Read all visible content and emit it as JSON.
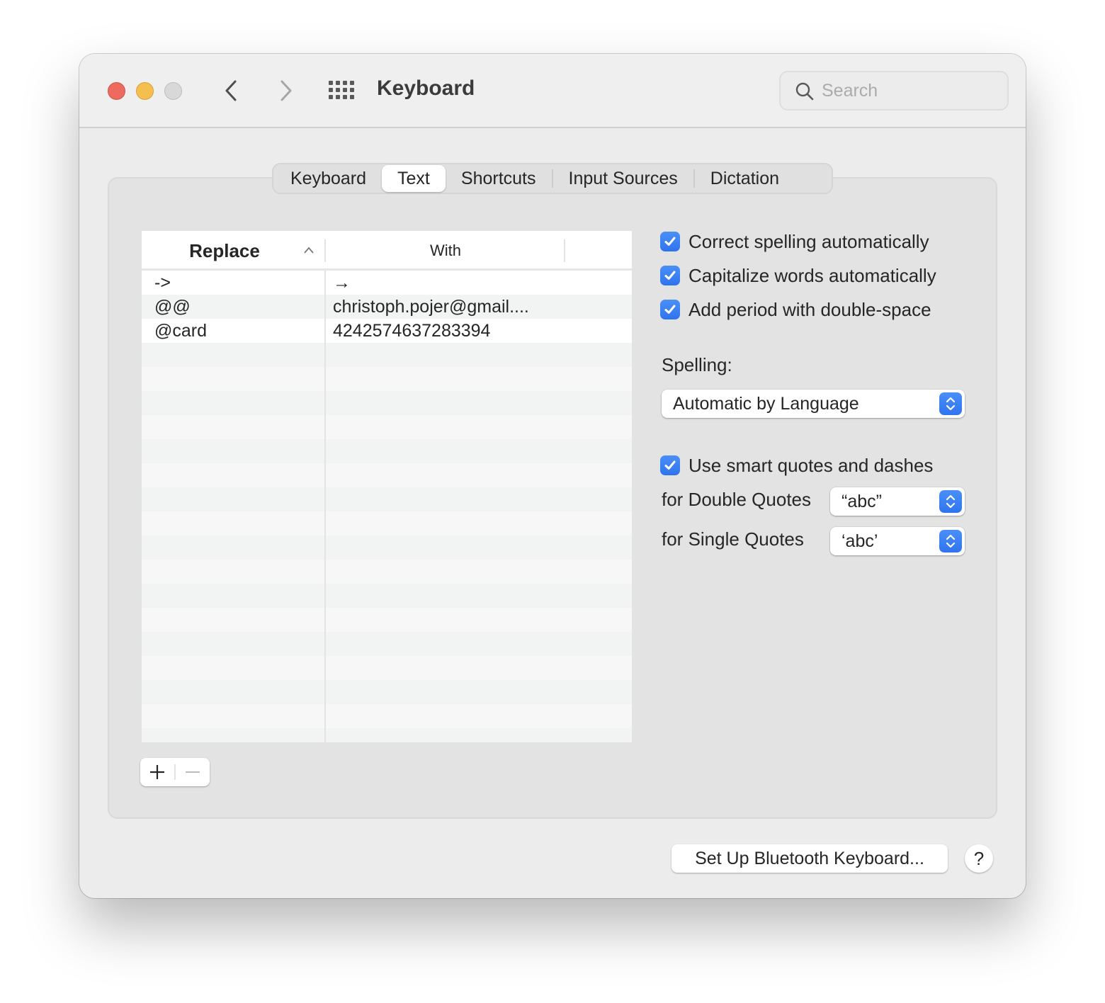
{
  "window": {
    "title": "Keyboard",
    "traffic_lights": [
      "close",
      "minimize",
      "zoom"
    ]
  },
  "toolbar": {
    "back_icon": "chevron-left-icon",
    "forward_icon": "chevron-right-icon",
    "grid_icon": "show-all-grid-icon",
    "search": {
      "placeholder": "Search",
      "value": ""
    }
  },
  "tabs": [
    {
      "label": "Keyboard",
      "active": false
    },
    {
      "label": "Text",
      "active": true
    },
    {
      "label": "Shortcuts",
      "active": false
    },
    {
      "label": "Input Sources",
      "active": false
    },
    {
      "label": "Dictation",
      "active": false
    }
  ],
  "replacements_table": {
    "columns": {
      "replace": "Replace",
      "with": "With"
    },
    "sort": {
      "column": "Replace",
      "direction": "ascending"
    },
    "rows": [
      {
        "replace": "->",
        "with": "→"
      },
      {
        "replace": "@@",
        "with": "christoph.pojer@gmail...."
      },
      {
        "replace": "@card",
        "with": "4242574637283394"
      }
    ],
    "add_label": "+",
    "remove_label": "−"
  },
  "options": {
    "correct_spelling": {
      "label": "Correct spelling automatically",
      "checked": true
    },
    "capitalize_words": {
      "label": "Capitalize words automatically",
      "checked": true
    },
    "double_space_period": {
      "label": "Add period with double-space",
      "checked": true
    },
    "spelling_label": "Spelling:",
    "spelling_value": "Automatic by Language",
    "smart_quotes": {
      "label": "Use smart quotes and dashes",
      "checked": true
    },
    "double_quotes_label": "for Double Quotes",
    "double_quotes_value": "“abc”",
    "single_quotes_label": "for Single Quotes",
    "single_quotes_value": "‘abc’"
  },
  "footer": {
    "bluetooth_button": "Set Up Bluetooth Keyboard...",
    "help_button": "?"
  },
  "colors": {
    "accent": "#3b82f6",
    "close": "#ed6a5e",
    "minimize": "#f5bf4f",
    "zoom_disabled": "#d8d8d8"
  }
}
